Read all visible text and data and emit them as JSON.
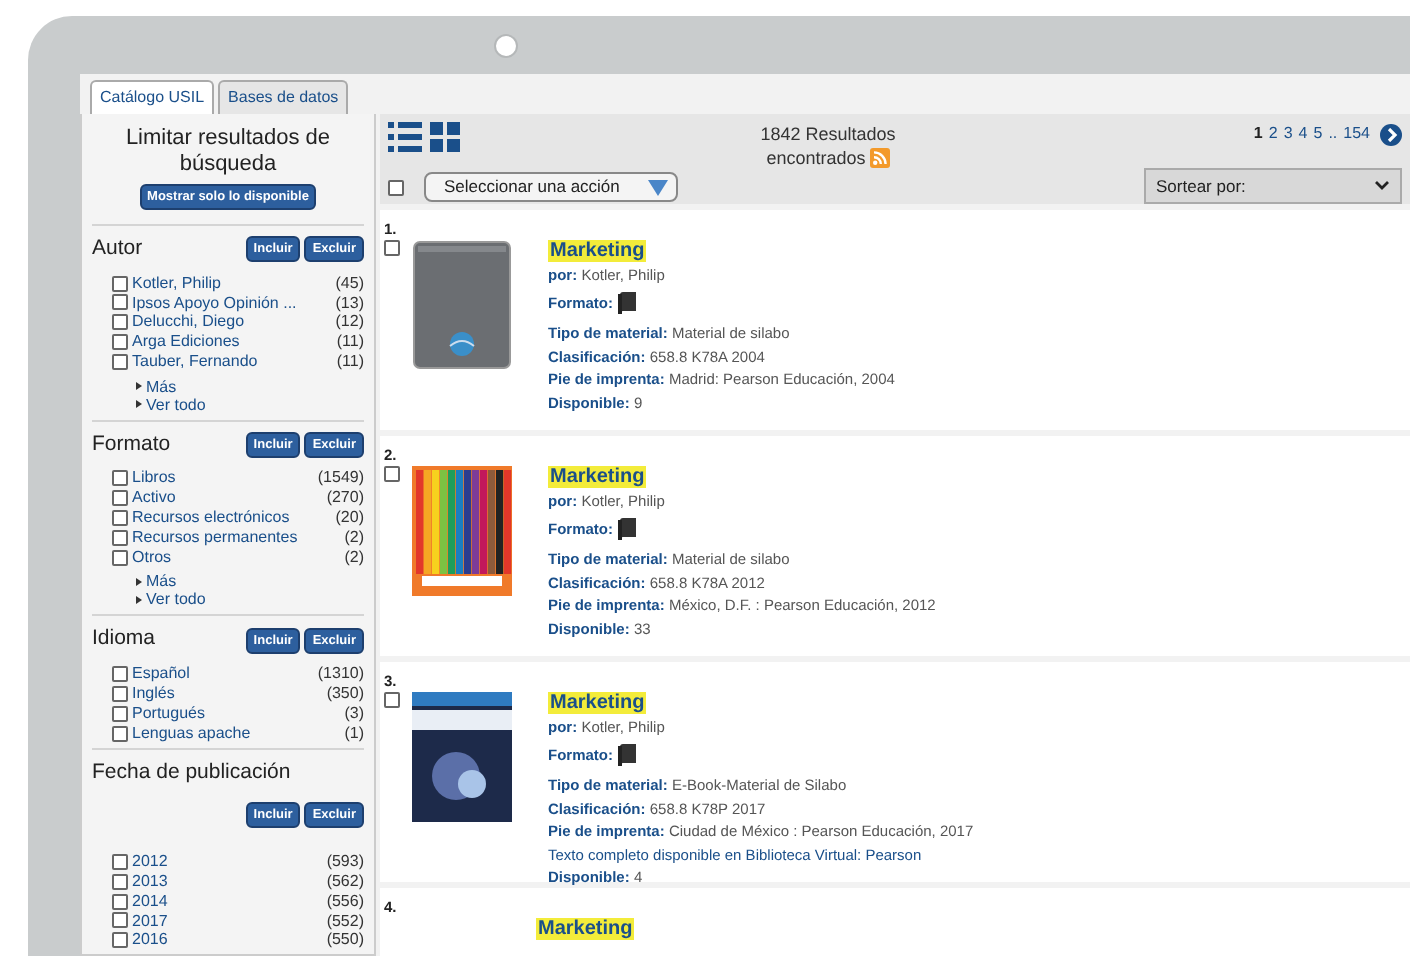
{
  "tabs": [
    {
      "label": "Catálogo USIL",
      "selected": true
    },
    {
      "label": "Bases de datos",
      "selected": false
    }
  ],
  "sidebar": {
    "title": "Limitar resultados de búsqueda",
    "available_button": "Mostrar solo lo disponible",
    "facets": [
      {
        "kind": "inline",
        "name": "Autor",
        "include": "Incluir",
        "exclude": "Excluir",
        "items": [
          {
            "label": "Kotler, Philip",
            "count": "(45)",
            "checked": false
          },
          {
            "label": "Ipsos Apoyo Opinión ...",
            "count": "(13)",
            "checked": false
          },
          {
            "label": "Delucchi, Diego",
            "count": "(12)",
            "checked": false
          },
          {
            "label": "Arga Ediciones",
            "count": "(11)",
            "checked": false
          },
          {
            "label": "Tauber, Fernando",
            "count": "(11)",
            "checked": false
          }
        ],
        "links": [
          "Más",
          "Ver todo"
        ]
      },
      {
        "kind": "inline",
        "name": "Formato",
        "include": "Incluir",
        "exclude": "Excluir",
        "items": [
          {
            "label": "Libros",
            "count": "(1549)",
            "checked": false
          },
          {
            "label": "Activo",
            "count": "(270)",
            "checked": false
          },
          {
            "label": "Recursos electrónicos",
            "count": "(20)",
            "checked": false
          },
          {
            "label": "Recursos permanentes",
            "count": "(2)",
            "checked": false
          },
          {
            "label": "Otros",
            "count": "(2)",
            "checked": false
          }
        ],
        "links": [
          "Más",
          "Ver todo"
        ]
      },
      {
        "kind": "inline",
        "name": "Idioma",
        "include": "Incluir",
        "exclude": "Excluir",
        "items": [
          {
            "label": "Español",
            "count": "(1310)",
            "checked": false
          },
          {
            "label": "Inglés",
            "count": "(350)",
            "checked": false
          },
          {
            "label": "Portugués",
            "count": "(3)",
            "checked": false
          },
          {
            "label": "Lenguas apache",
            "count": "(1)",
            "checked": false
          }
        ]
      },
      {
        "kind": "stacked",
        "name": "Fecha de publicación",
        "include": "Incluir",
        "exclude": "Excluir",
        "items": [
          {
            "label": "2012",
            "count": "(593)",
            "checked": false
          },
          {
            "label": "2013",
            "count": "(562)",
            "checked": false
          },
          {
            "label": "2014",
            "count": "(556)",
            "checked": false
          },
          {
            "label": "2017",
            "count": "(552)",
            "checked": false
          },
          {
            "label": "2016",
            "count": "(550)",
            "checked": false
          }
        ]
      }
    ]
  },
  "results_header": {
    "count_line_1": "1842 Resultados",
    "count_line_2": "encontrados",
    "pages": [
      {
        "label": "1",
        "selected": true
      },
      {
        "label": "2",
        "selected": false
      },
      {
        "label": "3",
        "selected": false
      },
      {
        "label": "4",
        "selected": false
      },
      {
        "label": "5",
        "selected": false
      },
      {
        "label": "..",
        "selected": false
      },
      {
        "label": "154",
        "selected": false
      }
    ],
    "select_all_checked": false,
    "action_select": "Seleccionar una acción",
    "sort_select": "Sortear por:"
  },
  "results": [
    {
      "number": "1.",
      "checked": false,
      "kind": "grey-book",
      "title": "Marketing",
      "author_label": "por:",
      "author": "Kotler, Philip",
      "format_label": "Formato:",
      "fields": [
        {
          "label": "Tipo de material:",
          "value": "Material de silabo"
        },
        {
          "label": "Clasificación:",
          "value": "658.8 K78A 2004"
        },
        {
          "label": "Pie de imprenta:",
          "value": "Madrid: Pearson Educación, 2004"
        }
      ],
      "available_label": "Disponible:",
      "available": "9"
    },
    {
      "number": "2.",
      "checked": false,
      "kind": "pencils",
      "title": "Marketing",
      "author_label": "por:",
      "author": "Kotler, Philip",
      "format_label": "Formato:",
      "fields": [
        {
          "label": "Tipo de material:",
          "value": "Material de silabo"
        },
        {
          "label": "Clasificación:",
          "value": "658.8 K78A 2012"
        },
        {
          "label": "Pie de imprenta:",
          "value": "México, D.F. : Pearson Educación, 2012"
        }
      ],
      "available_label": "Disponible:",
      "available": "33"
    },
    {
      "number": "3.",
      "checked": false,
      "kind": "digital",
      "title": "Marketing",
      "author_label": "por:",
      "author": "Kotler, Philip",
      "format_label": "Formato:",
      "fields": [
        {
          "label": "Tipo de material:",
          "value": "E-Book-Material de Silabo"
        },
        {
          "label": "Clasificación:",
          "value": "658.8 K78P 2017"
        },
        {
          "label": "Pie de imprenta:",
          "value": "Ciudad de México : Pearson Educación, 2017"
        }
      ],
      "link": "Texto completo disponible en Biblioteca Virtual: Pearson",
      "available_label": "Disponible:",
      "available": "4"
    },
    {
      "number": "4.",
      "title": "Marketing"
    }
  ]
}
